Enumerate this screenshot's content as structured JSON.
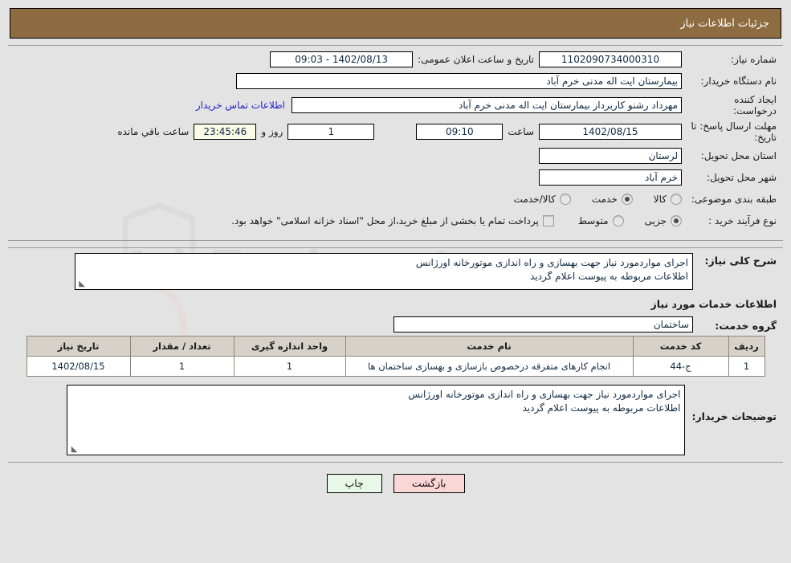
{
  "header": {
    "title": "جزئیات اطلاعات نیاز"
  },
  "form": {
    "need_number_label": "شماره نیاز:",
    "need_number_value": "1102090734000310",
    "public_announce_label": "تاریخ و ساعت اعلان عمومی:",
    "public_announce_value": "1402/08/13 - 09:03",
    "buyer_org_label": "نام دستگاه خریدار:",
    "buyer_org_value": "بیمارستان ایت اله مدنی خرم آباد",
    "requester_label": "ایجاد کننده درخواست:",
    "requester_value": "مهرداد رشنو کاربرداز بیمارستان ایت اله مدنی خرم آباد",
    "contact_link": "اطلاعات تماس خریدار",
    "deadline_label": "مهلت ارسال پاسخ: تا تاریخ:",
    "deadline_date": "1402/08/15",
    "hour_label": "ساعت",
    "hour_value": "09:10",
    "days_value": "1",
    "days_label": "روز و",
    "remaining_value": "23:45:46",
    "remaining_label": "ساعت باقي مانده",
    "province_label": "استان محل تحویل:",
    "province_value": "لرستان",
    "city_label": "شهر محل تحویل:",
    "city_value": "خرم آباد",
    "category_label": "طبقه بندی موضوعی:",
    "category_options": [
      {
        "label": "کالا",
        "selected": false
      },
      {
        "label": "خدمت",
        "selected": true
      },
      {
        "label": "کالا/خدمت",
        "selected": false
      }
    ],
    "process_label": "نوع فرآیند خرید :",
    "process_options": [
      {
        "label": "جزیی",
        "selected": true
      },
      {
        "label": "متوسط",
        "selected": false
      }
    ],
    "treasury_checkbox_text": "پرداخت تمام یا بخشی از مبلغ خرید،از محل \"اسناد خزانه اسلامی\" خواهد بود."
  },
  "description": {
    "label": "شرح کلی نیاز:",
    "value": "اجرای مواردمورد نیاز جهت بهسازی و راه اندازی موتورخانه اورژانس\nاطلاعات مربوطه به پیوست اعلام گردید"
  },
  "services_section": {
    "title": "اطلاعات خدمات مورد نیاز",
    "group_label": "گروه خدمت:",
    "group_value": "ساختمان"
  },
  "table": {
    "columns": [
      "ردیف",
      "کد خدمت",
      "نام خدمت",
      "واحد اندازه گیری",
      "تعداد / مقدار",
      "تاریخ نیاز"
    ],
    "rows": [
      {
        "row_no": "1",
        "service_code": "ج-44",
        "service_name": "انجام کارهای متفرقه درخصوص بازسازی و بهسازی ساختمان ها",
        "unit": "1",
        "quantity": "1",
        "need_date": "1402/08/15"
      }
    ]
  },
  "buyer_notes": {
    "label": "توضیحات خریدار:",
    "value": "اجرای مواردمورد نیاز جهت بهسازی و راه اندازی موتورخانه اورژانس\nاطلاعات مربوطه به پیوست اعلام گردید"
  },
  "footer": {
    "print_label": "چاپ",
    "back_label": "بازگشت"
  },
  "watermark": {
    "text": "AriaTender.net"
  },
  "colors": {
    "header_bar": "#8d6c41",
    "page_bg": "#e3e3e3",
    "table_header": "#d6d2ca",
    "link": "#2222cc",
    "print_btn": "#e8f7e8",
    "back_btn": "#fbd6d6",
    "highlight_field": "#fbfbe8"
  }
}
